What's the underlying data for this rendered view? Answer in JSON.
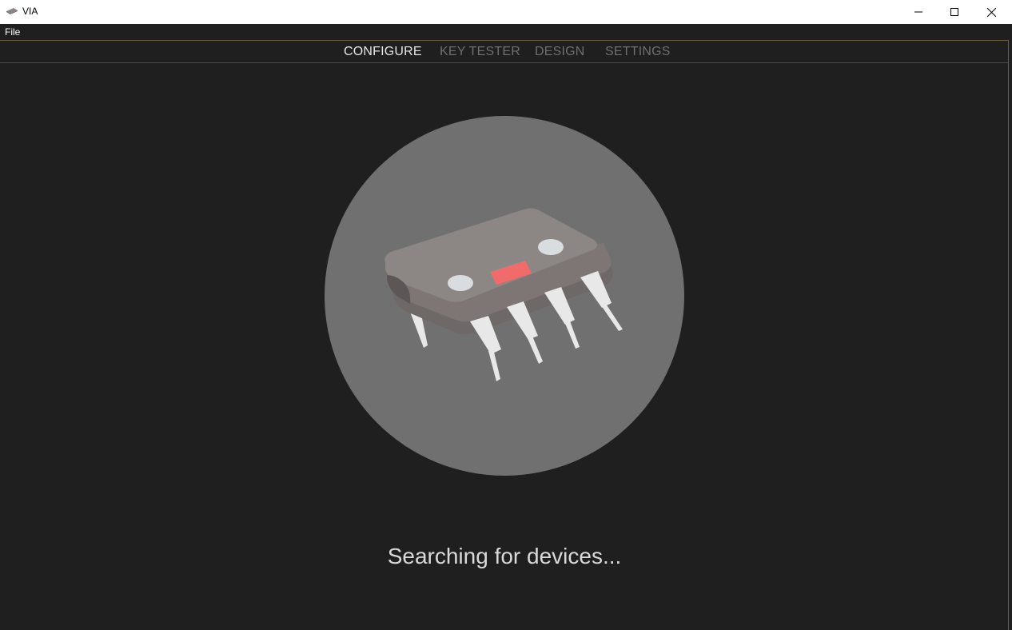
{
  "window": {
    "title": "VIA",
    "app_icon": "keyboard-chip-icon",
    "controls": [
      "minimize-icon",
      "maximize-icon",
      "close-icon"
    ]
  },
  "menu": {
    "file_label": "File"
  },
  "nav": {
    "tabs": [
      {
        "label": "CONFIGURE",
        "active": true
      },
      {
        "label": "KEY TESTER",
        "active": false
      },
      {
        "label": "DESIGN",
        "active": false
      },
      {
        "label": "SETTINGS",
        "active": false
      }
    ]
  },
  "main": {
    "illustration": "chip-icon",
    "status": "Searching for devices..."
  },
  "colors": {
    "background": "#1f1f1f",
    "circle": "#707070",
    "chip_body": "#8a8483",
    "chip_accent": "#f26b6b",
    "active_tab": "#e6e6e6",
    "inactive_tab": "#6f6f6f"
  }
}
